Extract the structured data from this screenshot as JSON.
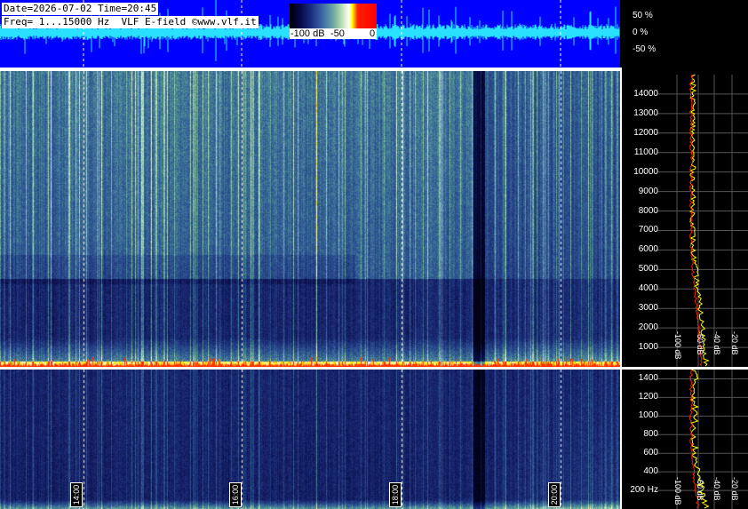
{
  "header": {
    "line1": "Date=2026-07-02 Time=20:45",
    "line2": "Freq= 1...15000 Hz  VLF E-field ©www.vlf.it"
  },
  "colorbar": {
    "labels": [
      "-100 dB",
      "-50",
      "0"
    ],
    "colors": [
      "#000000",
      "#0a0c50",
      "#3e6aa8",
      "#b8e0b0",
      "#ffffff",
      "#ffff00",
      "#ff0000"
    ]
  },
  "waveform": {
    "background": "#0000ff",
    "trace_color": "#29e0ff",
    "scale_labels": [
      "50 %",
      "0 %",
      "-50 %"
    ]
  },
  "time_labels": [
    "14:00",
    "16:00",
    "18:00",
    "20:00"
  ],
  "chart_data": [
    {
      "type": "heatmap",
      "x": [
        "14:00",
        "16:00",
        "18:00",
        "20:00"
      ],
      "y_ticks": [
        1000,
        2000,
        3000,
        4000,
        5000,
        6000,
        7000,
        8000,
        9000,
        10000,
        11000,
        12000,
        13000,
        14000
      ],
      "ylim": [
        0,
        15000
      ]
    },
    {
      "type": "heatmap",
      "x": [
        "14:00",
        "16:00",
        "18:00",
        "20:00"
      ],
      "y_ticks": [
        200,
        400,
        600,
        800,
        1000,
        1200,
        1400
      ],
      "y_unit": "Hz",
      "ylim": [
        0,
        1500
      ]
    },
    {
      "type": "line",
      "xlabels": [
        "-100 dB",
        "-60 dB",
        "-40 dB",
        "-20 dB"
      ],
      "series_colors": [
        "#ffff00",
        "#ff2000"
      ]
    },
    {
      "type": "line",
      "xlabels": [
        "-100 dB",
        "-60 dB",
        "-40 dB",
        "-20 dB"
      ],
      "series_colors": [
        "#ffff00",
        "#ff2000"
      ]
    }
  ]
}
